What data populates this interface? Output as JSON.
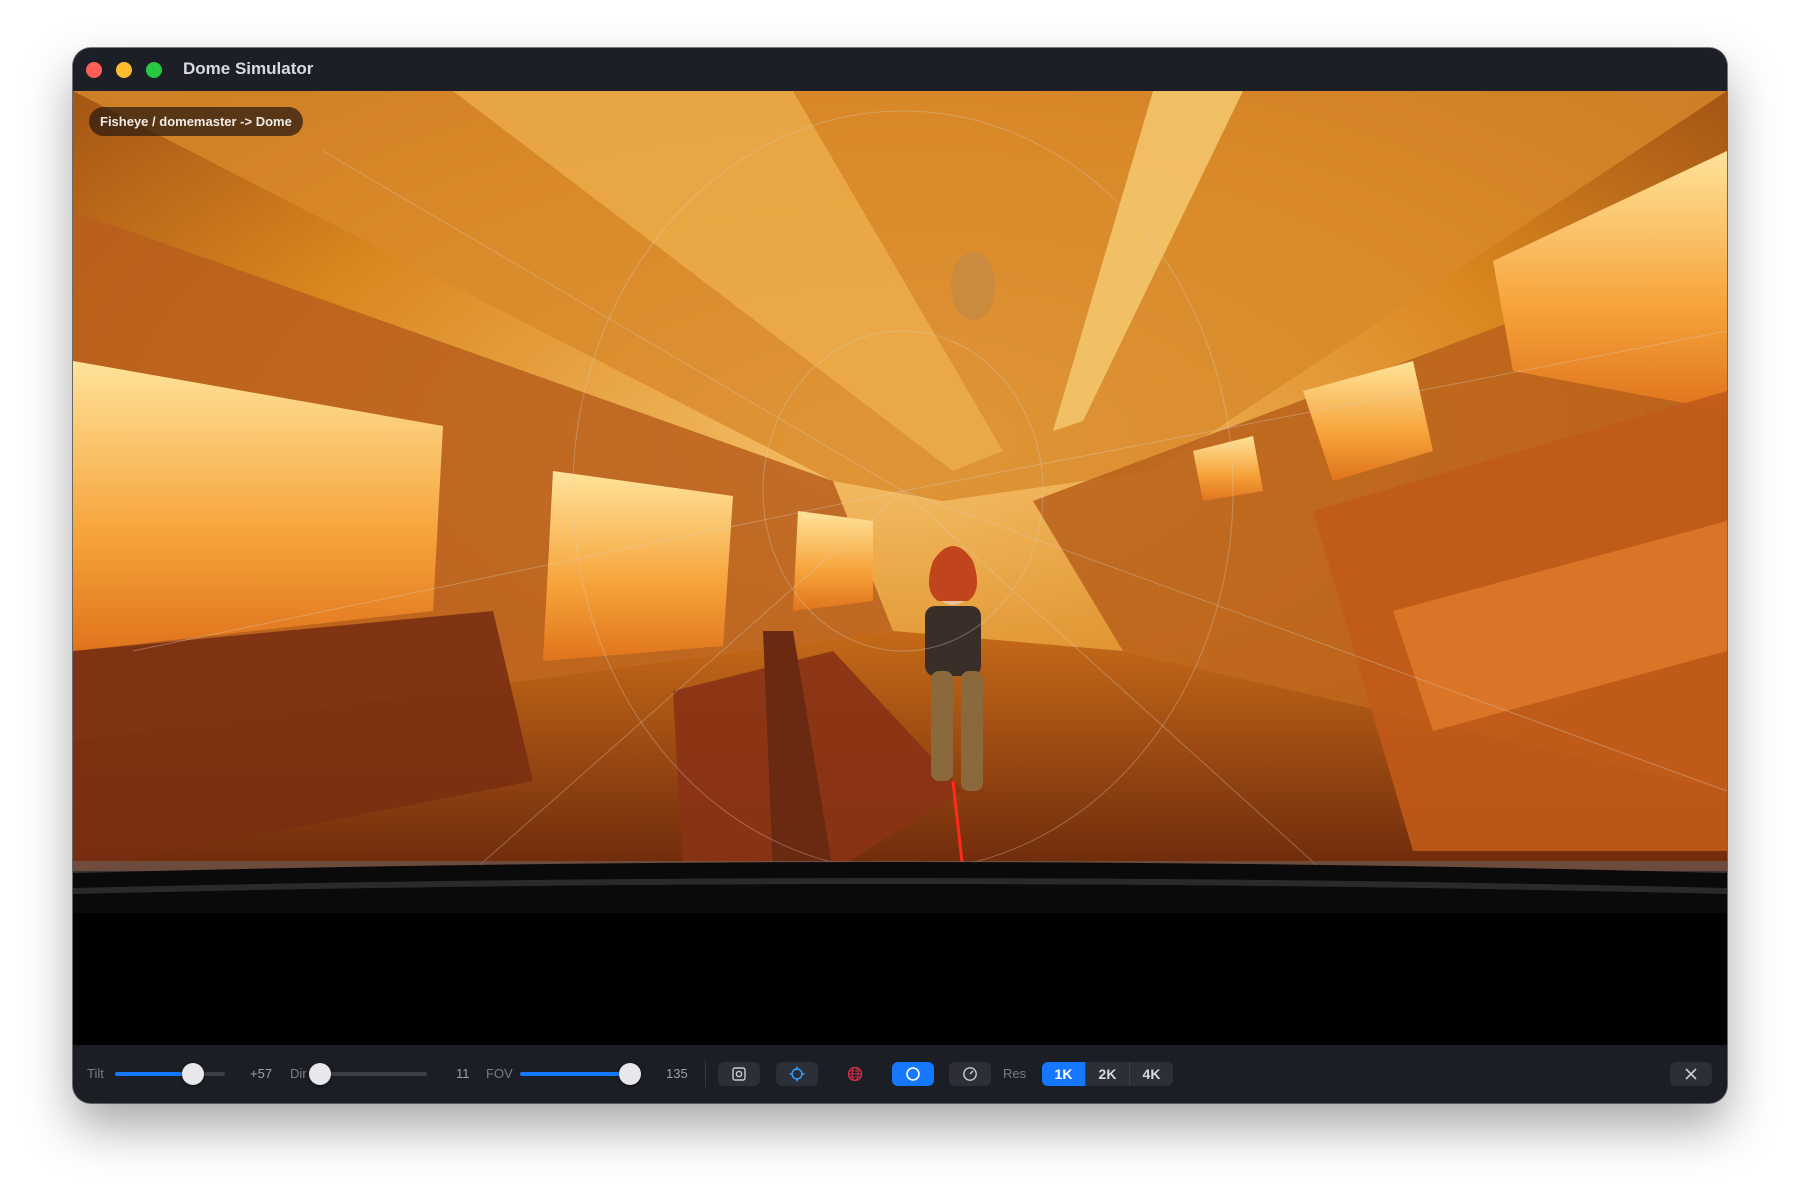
{
  "window": {
    "title": "Dome Simulator"
  },
  "viewport": {
    "mode_badge": "Fisheye / domemaster -> Dome",
    "scene_description_icon": "train-interior-image"
  },
  "controls": {
    "tilt": {
      "label": "Tilt",
      "value": "+57",
      "fraction": 0.71
    },
    "dir": {
      "label": "Dir",
      "value": "11",
      "fraction": 0.03
    },
    "fov": {
      "label": "FOV",
      "value": "135",
      "fraction": 1.0
    },
    "buttons": [
      {
        "name": "screenshot-button",
        "icon": "screenshot-icon",
        "active": false
      },
      {
        "name": "crosshair-button",
        "icon": "crosshair-icon",
        "active": false
      },
      {
        "name": "grid-button",
        "icon": "globe-grid-icon",
        "active": false
      },
      {
        "name": "dome-mode-button",
        "icon": "circle-icon",
        "active": true
      },
      {
        "name": "speed-button",
        "icon": "gauge-icon",
        "active": false
      }
    ],
    "res": {
      "label": "Res",
      "options": [
        "1K",
        "2K",
        "4K"
      ],
      "selected": "1K"
    },
    "close_icon": "close-icon"
  },
  "colors": {
    "accent": "#1677ff",
    "toolbar_bg": "#1b1e25",
    "titlebar_bg": "#1c1f26"
  }
}
